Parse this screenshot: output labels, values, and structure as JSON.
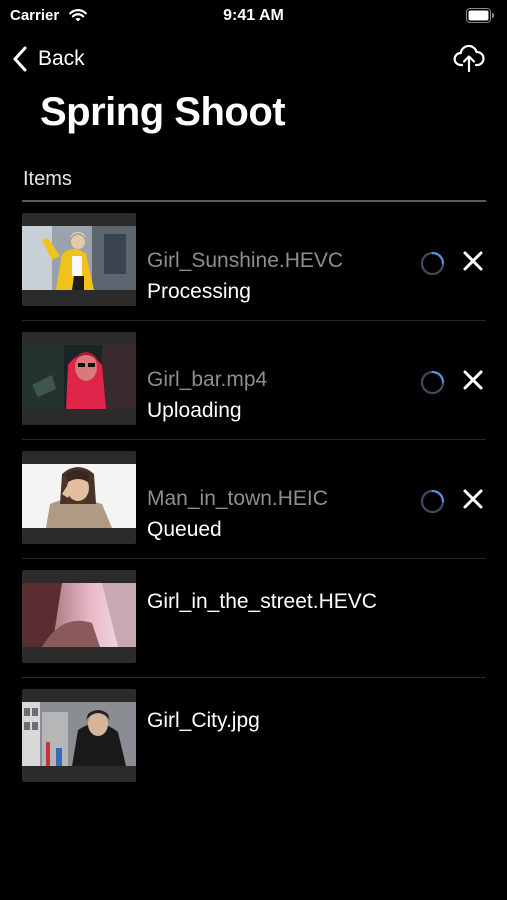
{
  "status_bar": {
    "carrier": "Carrier",
    "time": "9:41 AM"
  },
  "nav": {
    "back_label": "Back"
  },
  "title": "Spring Shoot",
  "section_label": "Items",
  "items": [
    {
      "name": "Girl_Sunshine.HEVC",
      "status": "Processing",
      "thumb": "yellow-jacket-photo"
    },
    {
      "name": "Girl_bar.mp4",
      "status": "Uploading",
      "thumb": "red-hair-photo"
    },
    {
      "name": "Man_in_town.HEIC",
      "status": "Queued",
      "thumb": "portrait-photo"
    },
    {
      "name": "Girl_in_the_street.HEVC",
      "status": "",
      "thumb": "street-photo"
    },
    {
      "name": "Girl_City.jpg",
      "status": "",
      "thumb": "city-photo"
    }
  ],
  "colors": {
    "background": "#000000",
    "accent_spinner": "#4a7fd4",
    "dim_text": "#8e8e8e"
  },
  "icons": {
    "back": "chevron-left-icon",
    "upload": "cloud-upload-icon",
    "cancel": "close-icon",
    "spinner": "loading-spinner-icon"
  }
}
